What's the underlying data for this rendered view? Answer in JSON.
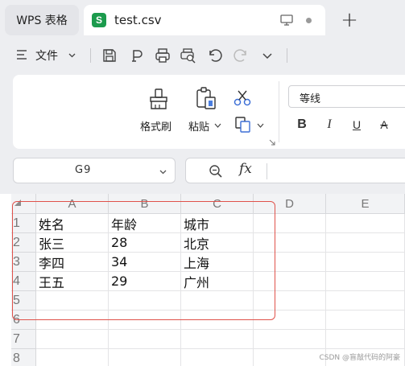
{
  "tabs": {
    "app_tab_label": "WPS 表格",
    "file_tab_label": "test.csv",
    "file_logo_letter": "S",
    "new_tab_symbol": "+"
  },
  "quickbar": {
    "menu_label": "文件"
  },
  "ribbon": {
    "format_painter_label": "格式刷",
    "paste_label": "粘贴",
    "font_name": "等线",
    "bold": "B",
    "italic": "I",
    "underline": "U",
    "strikethrough": "A"
  },
  "formula_bar": {
    "cell_reference": "G9",
    "fx_label": "fx",
    "formula_value": ""
  },
  "grid": {
    "column_headers": [
      "A",
      "B",
      "C",
      "D",
      "E"
    ],
    "row_headers": [
      "1",
      "2",
      "3",
      "4",
      "5",
      "6",
      "7",
      "8"
    ],
    "rows": [
      [
        "姓名",
        "年龄",
        "城市",
        "",
        ""
      ],
      [
        "张三",
        "28",
        "北京",
        "",
        ""
      ],
      [
        "李四",
        "34",
        "上海",
        "",
        ""
      ],
      [
        "王五",
        "29",
        "广州",
        "",
        ""
      ],
      [
        "",
        "",
        "",
        "",
        ""
      ],
      [
        "",
        "",
        "",
        "",
        ""
      ],
      [
        "",
        "",
        "",
        "",
        ""
      ],
      [
        "",
        "",
        "",
        "",
        ""
      ]
    ]
  },
  "colors": {
    "sheet_logo": "#1c9b4d",
    "highlight_box": "#e0524b"
  },
  "watermark": "CSDN @盲敲代码的阿豪"
}
